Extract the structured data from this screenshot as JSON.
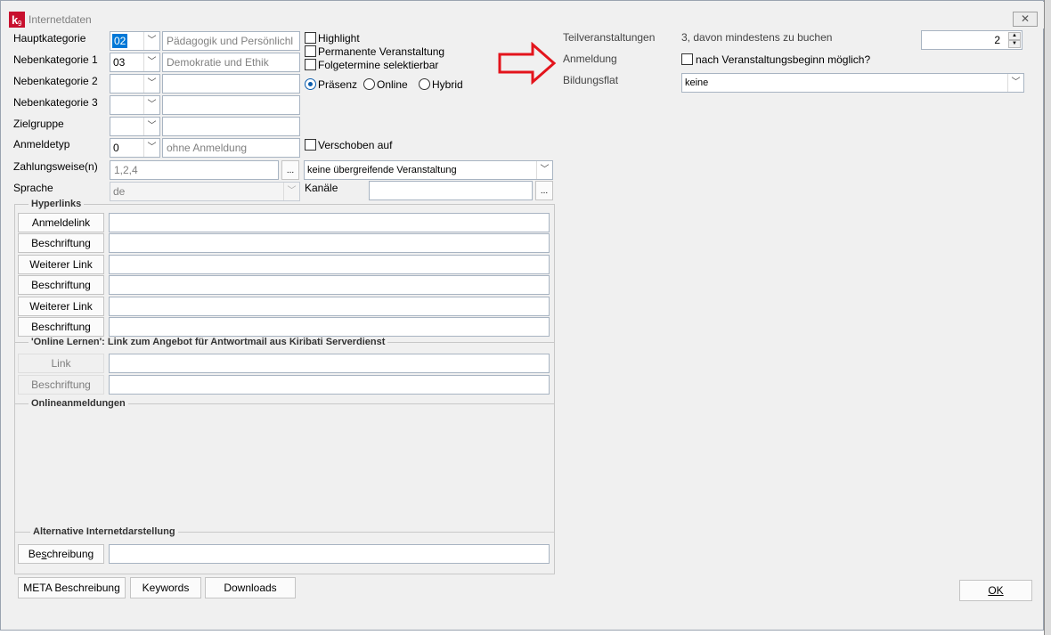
{
  "window": {
    "title": "Internetdaten",
    "close_label": "✕"
  },
  "left": {
    "hauptkategorie": {
      "label": "Hauptkategorie",
      "code": "02",
      "text": "Pädagogik und Persönlichl"
    },
    "nebenkategorie1": {
      "label": "Nebenkategorie 1",
      "code": "03",
      "text": "Demokratie und Ethik"
    },
    "nebenkategorie2": {
      "label": "Nebenkategorie 2",
      "code": "",
      "text": ""
    },
    "nebenkategorie3": {
      "label": "Nebenkategorie 3",
      "code": "",
      "text": ""
    },
    "zielgruppe": {
      "label": "Zielgruppe",
      "code": "",
      "text": ""
    },
    "anmeldetyp": {
      "label": "Anmeldetyp",
      "code": "0",
      "text": "ohne Anmeldung"
    },
    "zahlungsweise": {
      "label": "Zahlungsweise(n)",
      "value": "1,2,4",
      "dots": "..."
    },
    "sprache": {
      "label": "Sprache",
      "value": "de"
    }
  },
  "options": {
    "highlight": "Highlight",
    "permanente": "Permanente Veranstaltung",
    "folgetermine": "Folgetermine selektierbar",
    "praesenz": "Präsenz",
    "online": "Online",
    "hybrid": "Hybrid",
    "verschoben": "Verschoben auf",
    "uebergreifend": "keine übergreifende Veranstaltung",
    "kanaele_label": "Kanäle",
    "kanaele_value": "",
    "kanaele_dots": "..."
  },
  "hyperlinks": {
    "title": "Hyperlinks",
    "rows": [
      {
        "button": "Anmeldelink",
        "value": ""
      },
      {
        "button": "Beschriftung",
        "value": ""
      },
      {
        "button": "Weiterer Link",
        "value": ""
      },
      {
        "button": "Beschriftung",
        "value": ""
      },
      {
        "button": "Weiterer Link",
        "value": ""
      },
      {
        "button": "Beschriftung",
        "value": ""
      }
    ]
  },
  "online_lernen": {
    "title": "'Online Lernen': Link zum Angebot für Antwortmail aus Kiribati Serverdienst",
    "link_button": "Link",
    "beschriftung_button": "Beschriftung"
  },
  "onlineanmeldungen": {
    "title": "Onlineanmeldungen"
  },
  "alternative": {
    "title": "Alternative Internetdarstellung",
    "button_pre": "Be",
    "button_ul": "s",
    "button_post": "chreibung",
    "value": ""
  },
  "bottom_buttons": {
    "meta": "META Beschreibung",
    "keywords": "Keywords",
    "downloads": "Downloads"
  },
  "ok_button": "OK",
  "right": {
    "teilveranstaltungen_label": "Teilveranstaltungen",
    "teilveranstaltungen_text": "3, davon mindestens zu buchen",
    "teilveranstaltungen_value": "2",
    "anmeldung_label": "Anmeldung",
    "anmeldung_checkbox": "nach Veranstaltungsbeginn möglich?",
    "bildungsflat_label": "Bildungsflat",
    "bildungsflat_value": "keine"
  },
  "colors": {
    "arrow": "#e3141c",
    "selection": "#0078d7"
  }
}
